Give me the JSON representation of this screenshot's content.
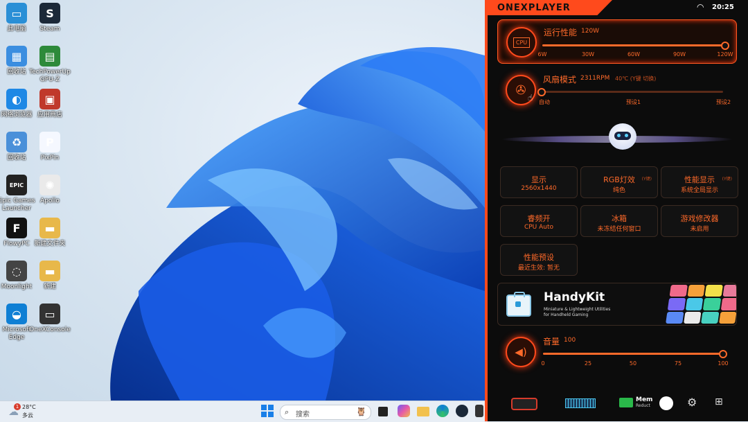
{
  "desktop": {
    "icons": [
      {
        "label": "此电脑",
        "glyph": "▭",
        "color": "#2a8fd6"
      },
      {
        "label": "Steam",
        "glyph": "S",
        "color": "#1b2838"
      },
      {
        "label": "回收站",
        "glyph": "▦",
        "color": "#3b8ee0"
      },
      {
        "label": "TechPowerUp GPU-Z",
        "glyph": "▤",
        "color": "#2d8a3a"
      },
      {
        "label": "网络浏览器",
        "glyph": "◐",
        "color": "#1e88e5"
      },
      {
        "label": "应用商店",
        "glyph": "▣",
        "color": "#c0392b"
      },
      {
        "label": "回收站",
        "glyph": "♻",
        "color": "#4a90d9"
      },
      {
        "label": "PixPin",
        "glyph": "P",
        "color": "#f5f8ff"
      },
      {
        "label": "Epic Games Launcher",
        "glyph": "EPIC",
        "color": "#222"
      },
      {
        "label": "Apollo",
        "glyph": "✺",
        "color": "#eaeaea"
      },
      {
        "label": "FlowyPC",
        "glyph": "F",
        "color": "#111"
      },
      {
        "label": "新建文件夹",
        "glyph": "▬",
        "color": "#e8b84a"
      },
      {
        "label": "Moonlight",
        "glyph": "◌",
        "color": "#444"
      },
      {
        "label": "新建",
        "glyph": "▬",
        "color": "#e8b84a"
      },
      {
        "label": "Microsoft Edge",
        "glyph": "◒",
        "color": "#0f7fd4"
      },
      {
        "label": "OneXConsole",
        "glyph": "▭",
        "color": "#333"
      }
    ]
  },
  "taskbar": {
    "weather_temp": "28°C",
    "weather_desc": "多云",
    "notification_count": "1",
    "search_placeholder": "搜索"
  },
  "panel": {
    "brand": "ONEXPLAYER",
    "time": "20:25",
    "performance": {
      "title": "运行性能",
      "value": "120W",
      "ticks": [
        "6W",
        "30W",
        "60W",
        "90W",
        "120W"
      ],
      "level": 1.0
    },
    "fan": {
      "title": "风扇模式",
      "rpm": "2311RPM",
      "temp": "40℃ (Y键 切换)",
      "ticks": [
        "自动",
        "预设1",
        "预设2"
      ],
      "level": 0.0
    },
    "tiles": [
      {
        "title": "显示",
        "sub": "2560x1440"
      },
      {
        "title": "RGB灯效",
        "tag": "(Y键)",
        "sub": "纯色"
      },
      {
        "title": "性能显示",
        "tag": "(Y键)",
        "sub": "系统全局显示"
      },
      {
        "title": "睿频开",
        "sub": "CPU Auto"
      },
      {
        "title": "冰箱",
        "sub": "未冻结任何窗口"
      },
      {
        "title": "游戏修改器",
        "sub": "未启用"
      },
      {
        "title": "性能预设",
        "sub": "最近生效: 暂无"
      }
    ],
    "handykit": {
      "title": "HandyKit",
      "sub1": "Miniature & Lightweight Utilities",
      "sub2": "for Handheld Gaming"
    },
    "volume": {
      "title": "音量",
      "value": "100",
      "ticks": [
        "0",
        "25",
        "50",
        "75",
        "100"
      ],
      "level": 1.0
    },
    "bottom": {
      "mem_label": "Mem",
      "mem_sub": "Reduct"
    }
  }
}
